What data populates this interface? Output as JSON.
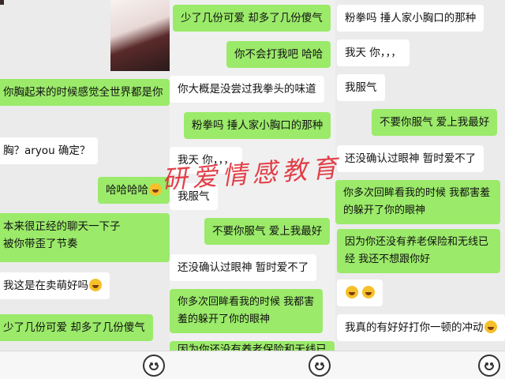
{
  "panel1": {
    "messages": [
      {
        "text": "你胸起来的时候感觉全世界都是你"
      },
      {
        "text": "胸？aryou 确定？"
      },
      {
        "text": "哈哈哈哈"
      },
      {
        "text": "本来很正经的聊天一下子"
      },
      {
        "text": "被你带歪了节奏"
      },
      {
        "text": "我这是在卖萌好吗"
      },
      {
        "text": "少了几份可爱  却多了几份傻气"
      }
    ]
  },
  "panel2": {
    "messages": [
      {
        "text": "少了几份可爱  却多了几份傻气"
      },
      {
        "text": "你不会打我吧  哈哈"
      },
      {
        "text": "你大概是没尝过我拳头的味道"
      },
      {
        "text": "粉拳吗    捶人家小胸口的那种"
      },
      {
        "text": "我天   你，，，"
      },
      {
        "text": "我服气"
      },
      {
        "text": "不要你服气    爱上我最好"
      },
      {
        "text": "还没确认过眼神    暂时爱不了"
      },
      {
        "text": "你多次回眸看我的时候   我都害羞的躲开了你的眼神"
      },
      {
        "text": "因为你还没有养老保险和无线已"
      }
    ]
  },
  "panel3": {
    "messages": [
      {
        "text": "粉拳吗    捶人家小胸口的那种"
      },
      {
        "text": "我天    你，，，"
      },
      {
        "text": "我服气"
      },
      {
        "text": "不要你服气    爱上我最好"
      },
      {
        "text": "还没确认过眼神    暂时爱不了"
      },
      {
        "text": "你多次回眸看我的时候    我都害羞的躲开了你的眼神"
      },
      {
        "text": "因为你还没有养老保险和无线已经    我还不想跟你好"
      },
      {
        "text": "我真的有好好打你一顿的冲动"
      }
    ]
  },
  "watermark": "研爱情感教育",
  "icons": {
    "emoji": "smiley-face-icon",
    "laugh": "laughing-emoji-icon"
  },
  "colors": {
    "sent": "#9bea6a",
    "received": "#ffffff",
    "watermark": "#e0303a"
  }
}
